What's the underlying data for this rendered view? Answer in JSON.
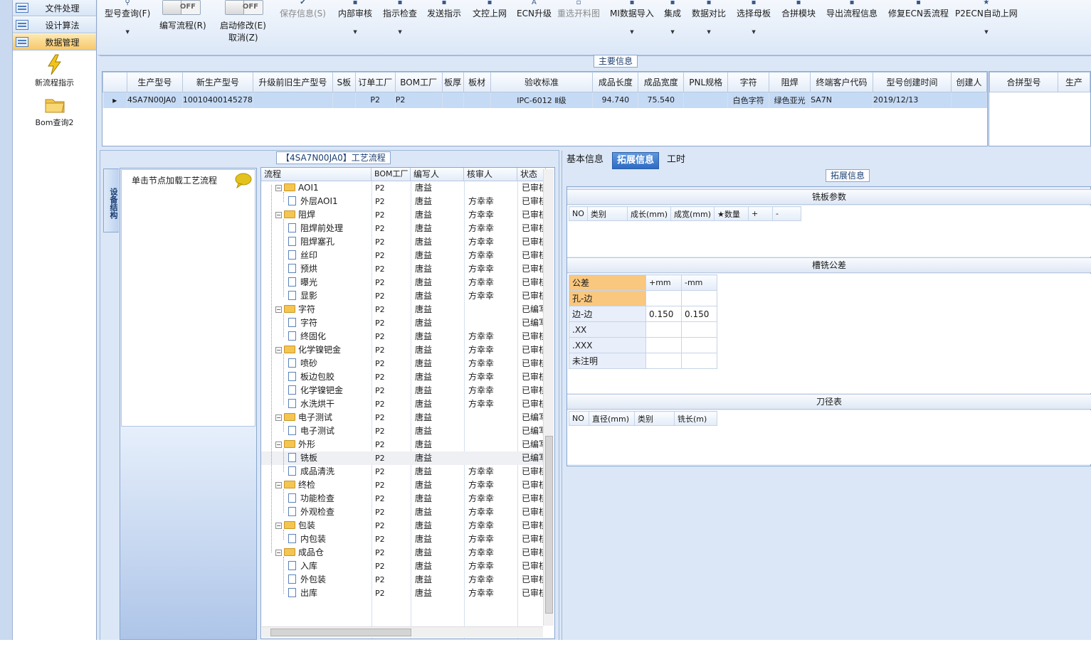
{
  "nav": {
    "items": [
      "文件处理",
      "设计算法",
      "数据管理"
    ],
    "big_icons": [
      "新流程指示",
      "Bom查询2"
    ]
  },
  "toolbar": {
    "buttons": [
      "型号查询(F)",
      "编写流程(R)",
      "启动修改(E)",
      "取消(Z)",
      "保存信息(S)",
      "内部审核",
      "指示检查",
      "发送指示",
      "文控上网",
      "ECN升级",
      "重选开料图",
      "MI数据导入",
      "集成",
      "数据对比",
      "选择母板",
      "合拼模块",
      "导出流程信息",
      "修复ECN丢流程",
      "P2ECN自动上网"
    ],
    "toggle_off": "OFF"
  },
  "main_info": {
    "title": "主要信息",
    "columns": [
      "生产型号",
      "新生产型号",
      "升级前旧生产型号",
      "S板",
      "订单工厂",
      "BOM工厂",
      "板厚",
      "板材",
      "验收标准",
      "成品长度",
      "成品宽度",
      "PNL规格",
      "字符",
      "阻焊",
      "终端客户代码",
      "型号创建时间",
      "创建人"
    ],
    "row": [
      "4SA7N00JA0",
      "10010400145278",
      "",
      "",
      "P2",
      "P2",
      "",
      "",
      "IPC-6012 Ⅱ级",
      "94.740",
      "75.540",
      "",
      "白色字符",
      "绿色亚光",
      "SA7N",
      "2019/12/13",
      ""
    ],
    "merge_columns": [
      "合拼型号",
      "生产"
    ]
  },
  "process": {
    "title": "【4SA7N00JA0】工艺流程",
    "side_tab": "设备结构",
    "hint": "单击节点加载工艺流程",
    "columns": [
      "流程",
      "BOM工厂",
      "编写人",
      "核审人",
      "状态"
    ],
    "rows": [
      {
        "name": "AOI1",
        "level": 0,
        "factory": "P2",
        "writer": "唐益",
        "reviewer": "",
        "status": "已审核"
      },
      {
        "name": "外层AOI1",
        "level": 1,
        "factory": "P2",
        "writer": "唐益",
        "reviewer": "方幸幸",
        "status": "已审核"
      },
      {
        "name": "阻焊",
        "level": 0,
        "factory": "P2",
        "writer": "唐益",
        "reviewer": "方幸幸",
        "status": "已审核"
      },
      {
        "name": "阻焊前处理",
        "level": 1,
        "factory": "P2",
        "writer": "唐益",
        "reviewer": "方幸幸",
        "status": "已审核"
      },
      {
        "name": "阻焊塞孔",
        "level": 1,
        "factory": "P2",
        "writer": "唐益",
        "reviewer": "方幸幸",
        "status": "已审核"
      },
      {
        "name": "丝印",
        "level": 1,
        "factory": "P2",
        "writer": "唐益",
        "reviewer": "方幸幸",
        "status": "已审核"
      },
      {
        "name": "预烘",
        "level": 1,
        "factory": "P2",
        "writer": "唐益",
        "reviewer": "方幸幸",
        "status": "已审核"
      },
      {
        "name": "曝光",
        "level": 1,
        "factory": "P2",
        "writer": "唐益",
        "reviewer": "方幸幸",
        "status": "已审核"
      },
      {
        "name": "显影",
        "level": 1,
        "factory": "P2",
        "writer": "唐益",
        "reviewer": "方幸幸",
        "status": "已审核"
      },
      {
        "name": "字符",
        "level": 0,
        "factory": "P2",
        "writer": "唐益",
        "reviewer": "",
        "status": "已编写"
      },
      {
        "name": "字符",
        "level": 1,
        "factory": "P2",
        "writer": "唐益",
        "reviewer": "",
        "status": "已编写"
      },
      {
        "name": "终固化",
        "level": 1,
        "factory": "P2",
        "writer": "唐益",
        "reviewer": "方幸幸",
        "status": "已审核"
      },
      {
        "name": "化学镍钯金",
        "level": 0,
        "factory": "P2",
        "writer": "唐益",
        "reviewer": "方幸幸",
        "status": "已审核"
      },
      {
        "name": "喷砂",
        "level": 1,
        "factory": "P2",
        "writer": "唐益",
        "reviewer": "方幸幸",
        "status": "已审核"
      },
      {
        "name": "板边包胶",
        "level": 1,
        "factory": "P2",
        "writer": "唐益",
        "reviewer": "方幸幸",
        "status": "已审核"
      },
      {
        "name": "化学镍钯金",
        "level": 1,
        "factory": "P2",
        "writer": "唐益",
        "reviewer": "方幸幸",
        "status": "已审核"
      },
      {
        "name": "水洗烘干",
        "level": 1,
        "factory": "P2",
        "writer": "唐益",
        "reviewer": "方幸幸",
        "status": "已审核"
      },
      {
        "name": "电子测试",
        "level": 0,
        "factory": "P2",
        "writer": "唐益",
        "reviewer": "",
        "status": "已编写"
      },
      {
        "name": "电子测试",
        "level": 1,
        "factory": "P2",
        "writer": "唐益",
        "reviewer": "",
        "status": "已编写"
      },
      {
        "name": "外形",
        "level": 0,
        "factory": "P2",
        "writer": "唐益",
        "reviewer": "",
        "status": "已编写"
      },
      {
        "name": "铣板",
        "level": 1,
        "factory": "P2",
        "writer": "唐益",
        "reviewer": "",
        "status": "已编写"
      },
      {
        "name": "成品清洗",
        "level": 1,
        "factory": "P2",
        "writer": "唐益",
        "reviewer": "方幸幸",
        "status": "已审核"
      },
      {
        "name": "终检",
        "level": 0,
        "factory": "P2",
        "writer": "唐益",
        "reviewer": "方幸幸",
        "status": "已审核"
      },
      {
        "name": "功能检查",
        "level": 1,
        "factory": "P2",
        "writer": "唐益",
        "reviewer": "方幸幸",
        "status": "已审核"
      },
      {
        "name": "外观检查",
        "level": 1,
        "factory": "P2",
        "writer": "唐益",
        "reviewer": "方幸幸",
        "status": "已审核"
      },
      {
        "name": "包装",
        "level": 0,
        "factory": "P2",
        "writer": "唐益",
        "reviewer": "方幸幸",
        "status": "已审核"
      },
      {
        "name": "内包装",
        "level": 1,
        "factory": "P2",
        "writer": "唐益",
        "reviewer": "方幸幸",
        "status": "已审核"
      },
      {
        "name": "成品仓",
        "level": 0,
        "factory": "P2",
        "writer": "唐益",
        "reviewer": "方幸幸",
        "status": "已审核"
      },
      {
        "name": "入库",
        "level": 1,
        "factory": "P2",
        "writer": "唐益",
        "reviewer": "方幸幸",
        "status": "已审核"
      },
      {
        "name": "外包装",
        "level": 1,
        "factory": "P2",
        "writer": "唐益",
        "reviewer": "方幸幸",
        "status": "已审核"
      },
      {
        "name": "出库",
        "level": 1,
        "factory": "P2",
        "writer": "唐益",
        "reviewer": "方幸幸",
        "status": "已审核"
      }
    ],
    "highlighted_row": "铣板"
  },
  "right": {
    "tabs": [
      "基本信息",
      "拓展信息",
      "工时"
    ],
    "active_tab": "拓展信息",
    "ext_title": "拓展信息",
    "mill_params": {
      "title": "铣板参数",
      "columns": [
        "NO",
        "类别",
        "成长(mm)",
        "成宽(mm)",
        "★数量",
        "+",
        "-"
      ]
    },
    "slot_tolerance": {
      "title": "槽铣公差",
      "columns": [
        "公差",
        "+mm",
        "-mm"
      ],
      "rows": [
        [
          "孔-边",
          "",
          ""
        ],
        [
          "边-边",
          "0.150",
          "0.150"
        ],
        [
          ".XX",
          "",
          ""
        ],
        [
          ".XXX",
          "",
          ""
        ],
        [
          "未注明",
          "",
          ""
        ]
      ]
    },
    "tool_table": {
      "title": "刀径表",
      "columns": [
        "NO",
        "直径(mm)",
        "类别",
        "铣长(m)"
      ]
    }
  }
}
